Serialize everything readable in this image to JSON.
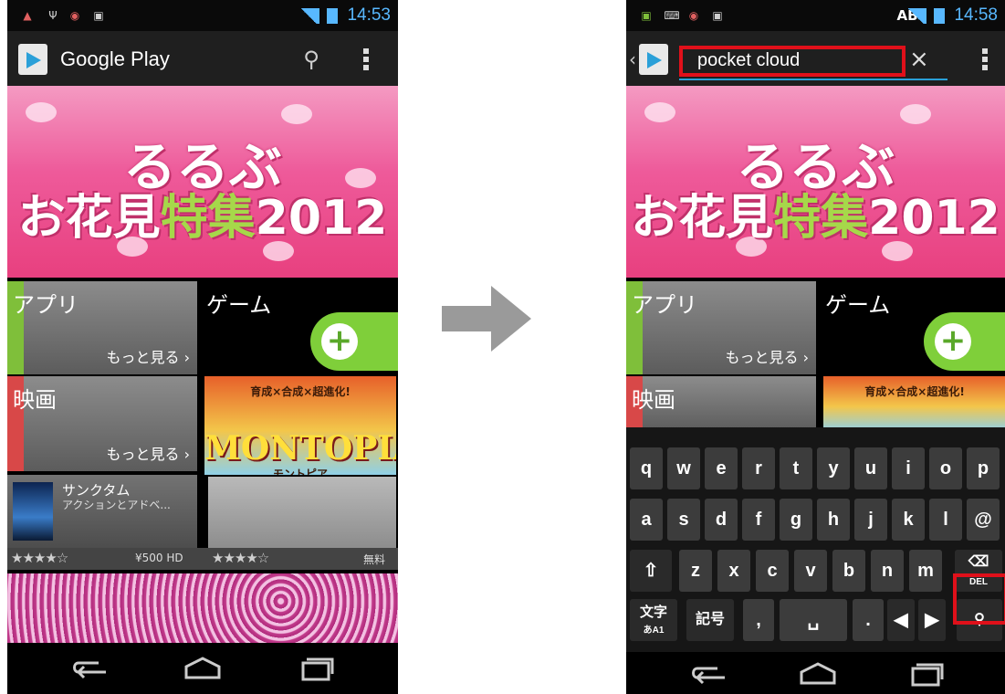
{
  "left": {
    "status": {
      "time": "14:53"
    },
    "appbar": {
      "title": "Google Play"
    },
    "banner": {
      "line1": "るるぶ",
      "line2a": "お花見",
      "line2b": "特集",
      "line2c": "2012"
    },
    "tiles": {
      "apps": "アプリ",
      "games": "ゲーム",
      "movies": "映画",
      "more": "もっと見る ›"
    },
    "promo": {
      "title": "MONTOPIA",
      "subtitle": "モントピア",
      "tag": "育成×合成×超進化!"
    },
    "app_card": {
      "name": "サンクタム",
      "desc": "アクションとアドベ...",
      "price": "¥500 HD"
    },
    "app_card2": {
      "price": "無料"
    }
  },
  "right": {
    "status": {
      "time": "14:58",
      "ime": "AB"
    },
    "search": {
      "query": "pocket cloud",
      "clear": "×"
    },
    "keyboard": {
      "row1": [
        "q",
        "w",
        "e",
        "r",
        "t",
        "y",
        "u",
        "i",
        "o",
        "p"
      ],
      "row2": [
        "a",
        "s",
        "d",
        "f",
        "g",
        "h",
        "j",
        "k",
        "l",
        "@"
      ],
      "row3": [
        "z",
        "x",
        "c",
        "v",
        "b",
        "n",
        "m"
      ],
      "del_label": "DEL",
      "mode_label": "文字",
      "mode_sub": "あA1",
      "symbols_label": "記号",
      "comma": ",",
      "period": ".",
      "search_label": "Q"
    }
  }
}
